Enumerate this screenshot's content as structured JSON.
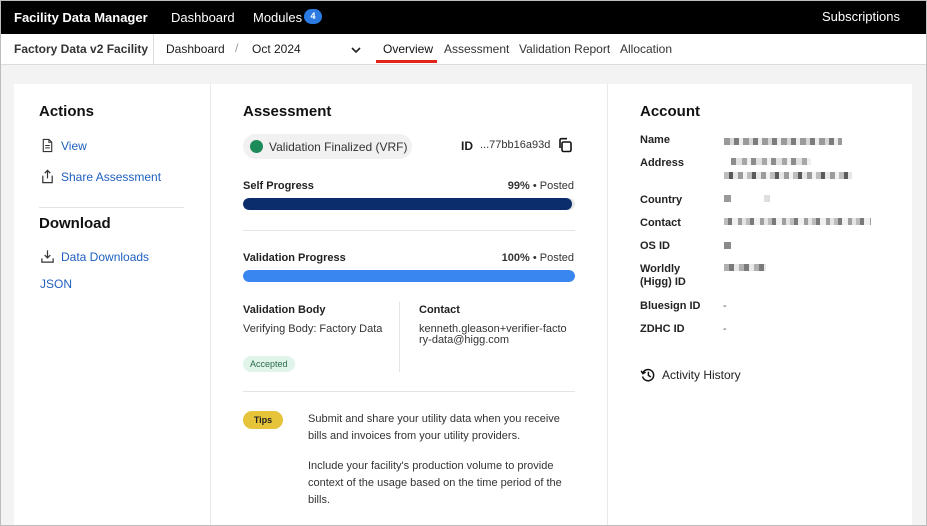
{
  "app": {
    "title": "Facility Data Manager",
    "nav": {
      "dashboard": "Dashboard",
      "modules": "Modules",
      "modules_count": "4"
    },
    "subscriptions": "Subscriptions"
  },
  "subnav": {
    "facility": "Factory Data v2 Facility",
    "breadcrumb": "Dashboard",
    "separator": "/",
    "period": "Oct 2024",
    "tabs": [
      "Overview",
      "Assessment",
      "Validation Report",
      "Allocation"
    ],
    "active_tab": "Overview"
  },
  "actions": {
    "title": "Actions",
    "items": [
      {
        "label": "View",
        "icon": "document-icon"
      },
      {
        "label": "Share Assessment",
        "icon": "share-icon"
      }
    ]
  },
  "download": {
    "title": "Download",
    "items": [
      {
        "label": "Data Downloads",
        "icon": "download-icon"
      },
      {
        "label": "JSON"
      }
    ]
  },
  "assessment": {
    "title": "Assessment",
    "status": "Validation Finalized (VRF)",
    "status_color": "#1d8a5a",
    "id_label": "ID",
    "id_value": "...77bb16a93d",
    "self_progress": {
      "label": "Self Progress",
      "percent": "99%",
      "state": "Posted",
      "value": 0.99,
      "color": "#0b2d6b"
    },
    "validation_progress": {
      "label": "Validation Progress",
      "percent": "100%",
      "state": "Posted",
      "value": 1.0,
      "color": "#3a86f0"
    },
    "dot_separator": "•",
    "validation_body": {
      "label": "Validation Body",
      "value": "Verifying Body: Factory Data",
      "badge": "Accepted"
    },
    "contact": {
      "label": "Contact",
      "value": "kenneth.gleason+verifier-factory-data@higg.com"
    },
    "tips": {
      "badge": "Tips",
      "paragraphs": [
        "Submit and share your utility data when you receive bills and invoices from your utility providers.",
        "Include your facility's production volume to provide context of the usage based on the time period of the bills."
      ]
    }
  },
  "account": {
    "title": "Account",
    "fields": [
      {
        "label": "Name",
        "value": ""
      },
      {
        "label": "Address",
        "value": ""
      },
      {
        "label": "Country",
        "value": ""
      },
      {
        "label": "Contact",
        "value": ""
      },
      {
        "label": "OS ID",
        "value": ""
      },
      {
        "label": "Worldly (Higg) ID",
        "value": ""
      },
      {
        "label": "Bluesign ID",
        "value": "-"
      },
      {
        "label": "ZDHC ID",
        "value": "-"
      }
    ],
    "activity": "Activity History"
  }
}
